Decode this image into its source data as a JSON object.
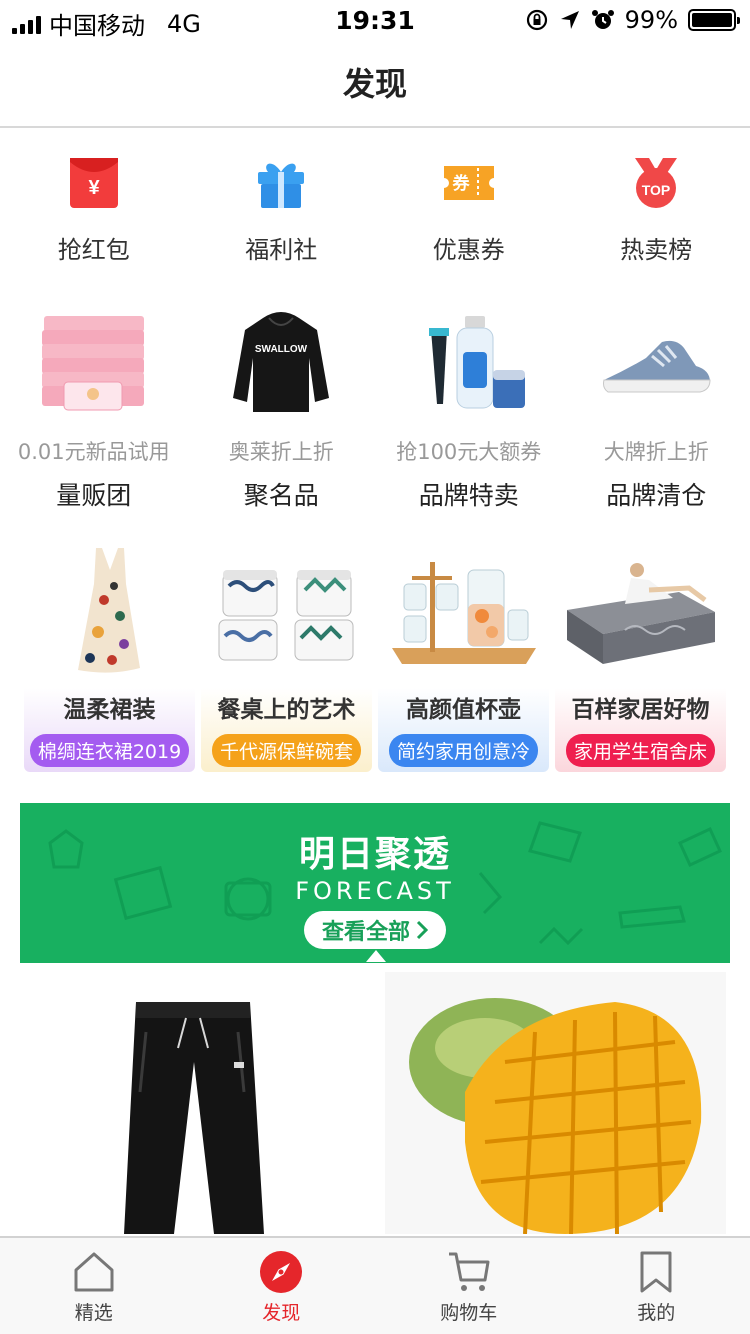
{
  "status_bar": {
    "carrier": "中国移动",
    "network": "4G",
    "time": "19:31",
    "battery": "99%",
    "battery_level": 0.99
  },
  "nav": {
    "title": "发现"
  },
  "quick_links": [
    {
      "label": "抢红包",
      "icon": "red-envelope-icon"
    },
    {
      "label": "福利社",
      "icon": "gift-box-icon"
    },
    {
      "label": "优惠券",
      "icon": "coupon-icon"
    },
    {
      "label": "热卖榜",
      "icon": "top-medal-icon"
    }
  ],
  "coupon_glyph": "券",
  "envelope_glyph": "¥",
  "medal_text": "TOP",
  "features": [
    {
      "subtitle": "0.01元新品试用",
      "title": "量贩团"
    },
    {
      "subtitle": "奥莱折上折",
      "title": "聚名品"
    },
    {
      "subtitle": "抢100元大额券",
      "title": "品牌特卖"
    },
    {
      "subtitle": "大牌折上折",
      "title": "品牌清仓"
    }
  ],
  "hoodie_text": "SWALLOW",
  "categories": [
    {
      "title": "温柔裙装",
      "tag": "棉绸连衣裙2019",
      "color": "#a45cf0"
    },
    {
      "title": "餐桌上的艺术",
      "tag": "千代源保鲜碗套",
      "color": "#f5a21a"
    },
    {
      "title": "高颜值杯壶",
      "tag": "简约家用创意冷",
      "color": "#3b86f0"
    },
    {
      "title": "百样家居好物",
      "tag": "家用学生宿舍床",
      "color": "#ef1f4f"
    }
  ],
  "banner": {
    "title": "明日聚透",
    "subtitle": "FORECAST",
    "button": "查看全部",
    "color": "#18b060"
  },
  "tabs": [
    {
      "label": "精选",
      "icon": "home-icon"
    },
    {
      "label": "发现",
      "icon": "compass-icon",
      "active": true
    },
    {
      "label": "购物车",
      "icon": "cart-icon"
    },
    {
      "label": "我的",
      "icon": "bookmark-icon"
    }
  ]
}
